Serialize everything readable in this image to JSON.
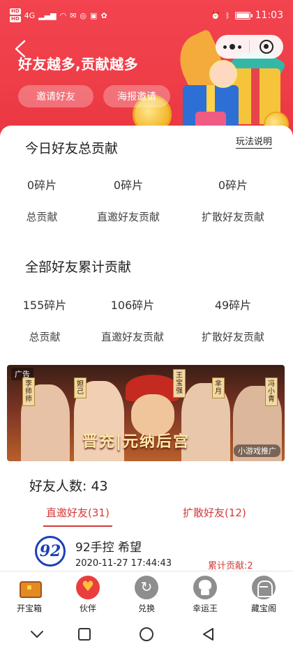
{
  "status_bar": {
    "carrier_tags": [
      "HD",
      "HD"
    ],
    "network": "4G",
    "time": "11:03",
    "battery_level": 0.9
  },
  "header": {
    "title": "好友越多,贡献越多",
    "invite_button": "邀请好友",
    "poster_button": "海报邀请"
  },
  "today": {
    "title": "今日好友总贡献",
    "rules_link": "玩法说明",
    "stats": [
      {
        "value": "0碎片",
        "label": "总贡献"
      },
      {
        "value": "0碎片",
        "label": "直邀好友贡献"
      },
      {
        "value": "0碎片",
        "label": "扩散好友贡献"
      }
    ]
  },
  "total": {
    "title": "全部好友累计贡献",
    "stats": [
      {
        "value": "155碎片",
        "label": "总贡献"
      },
      {
        "value": "106碎片",
        "label": "直邀好友贡献"
      },
      {
        "value": "49碎片",
        "label": "扩散好友贡献"
      }
    ]
  },
  "ad": {
    "tag": "广告",
    "names": [
      "李师师",
      "妲己",
      "王宝强",
      "芈月",
      "冯小青"
    ],
    "slogan": "晋充|元纳后宫",
    "promo": "小游戏推广"
  },
  "friends": {
    "count_label": "好友人数: 43",
    "tabs": [
      {
        "label": "直邀好友(31)",
        "active": true
      },
      {
        "label": "扩散好友(12)",
        "active": false
      }
    ],
    "list": [
      {
        "avatar_text": "92",
        "name": "92手控 希望",
        "time": "2020-11-27 17:44:43",
        "contribution": "累计贡献:2"
      }
    ]
  },
  "tabbar": {
    "items": [
      {
        "label": "开宝箱",
        "icon": "treasure-chest-icon"
      },
      {
        "label": "伙伴",
        "icon": "partner-heart-icon"
      },
      {
        "label": "兑换",
        "icon": "exchange-icon"
      },
      {
        "label": "幸运王",
        "icon": "lucky-king-icon"
      },
      {
        "label": "藏宝阁",
        "icon": "treasure-vault-icon"
      }
    ]
  },
  "colors": {
    "brand_red": "#ee3d47",
    "accent_red": "#d33b3b"
  }
}
